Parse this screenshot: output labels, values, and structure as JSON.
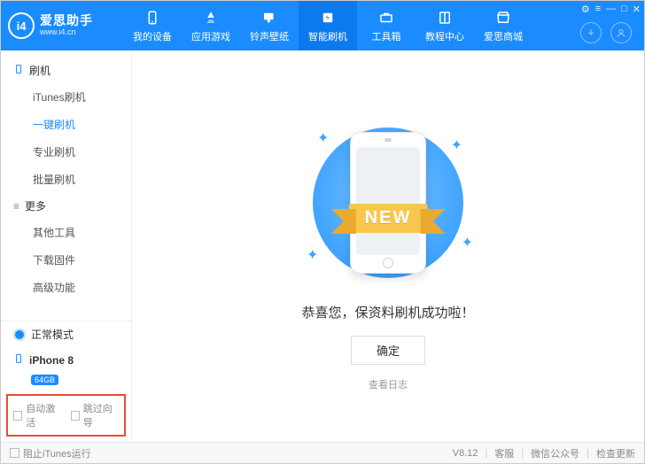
{
  "app": {
    "name": "爱思助手",
    "url": "www.i4.cn",
    "logo_text": "i4"
  },
  "nav": [
    {
      "label": "我的设备",
      "icon": "device"
    },
    {
      "label": "应用游戏",
      "icon": "apps"
    },
    {
      "label": "铃声壁纸",
      "icon": "music"
    },
    {
      "label": "智能刷机",
      "icon": "flash",
      "active": true
    },
    {
      "label": "工具箱",
      "icon": "toolbox"
    },
    {
      "label": "教程中心",
      "icon": "book"
    },
    {
      "label": "爱思商城",
      "icon": "shop"
    }
  ],
  "sidebar": {
    "group1": {
      "title": "刷机",
      "items": [
        "iTunes刷机",
        "一键刷机",
        "专业刷机",
        "批量刷机"
      ],
      "active_index": 1
    },
    "group2": {
      "title": "更多",
      "items": [
        "其他工具",
        "下载固件",
        "高级功能"
      ]
    },
    "mode": "正常模式",
    "device": {
      "name": "iPhone 8",
      "storage": "64GB"
    },
    "checks": {
      "auto_activate": "自动激活",
      "skip_guide": "跳过向导"
    }
  },
  "main": {
    "ribbon": "NEW",
    "success": "恭喜您，保资料刷机成功啦！",
    "confirm": "确定",
    "view_log": "查看日志"
  },
  "footer": {
    "block_itunes": "阻止iTunes运行",
    "version": "V8.12",
    "support": "客服",
    "wechat": "微信公众号",
    "update": "检查更新"
  }
}
